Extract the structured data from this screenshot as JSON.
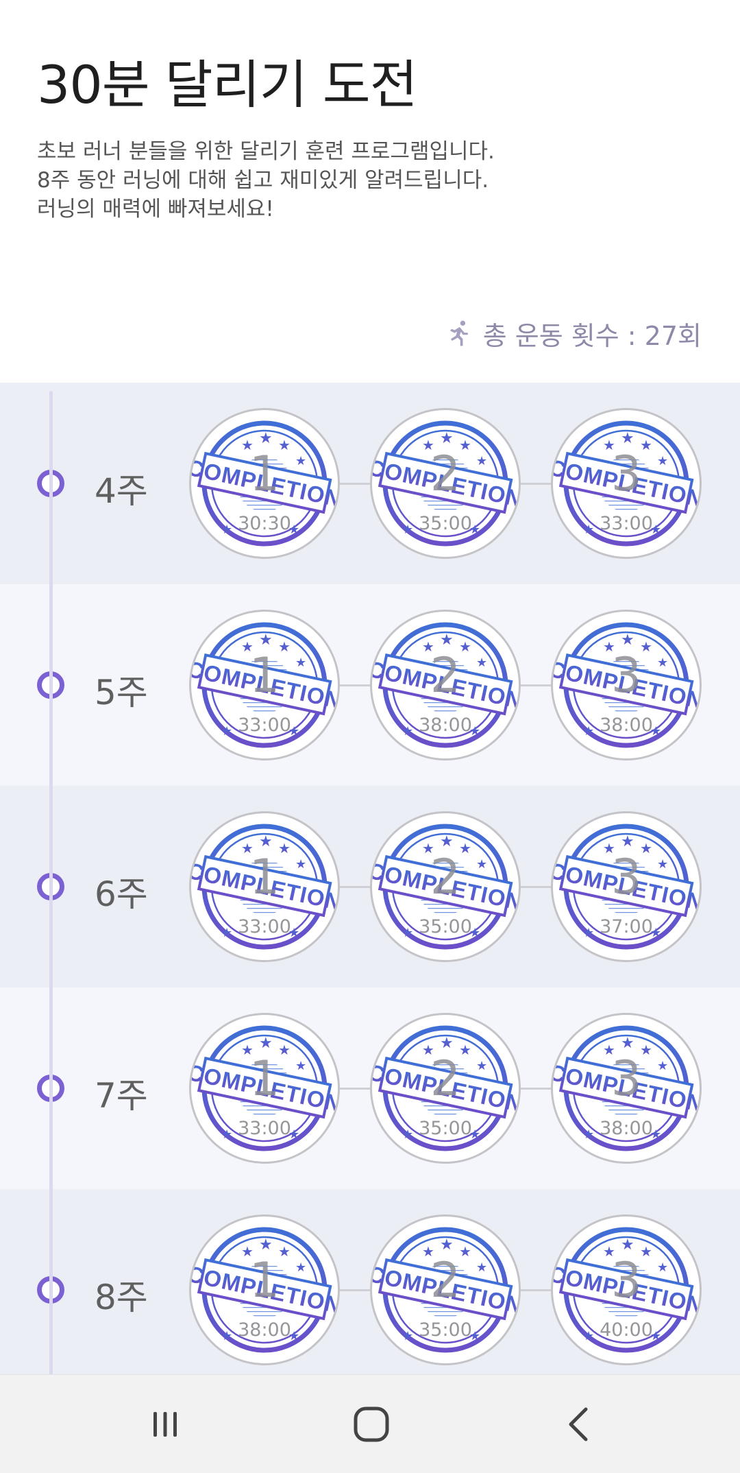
{
  "header": {
    "title": "30분 달리기 도전",
    "description": [
      "초보 러너 분들을 위한 달리기 훈련 프로그램입니다.",
      "8주 동안 러닝에 대해 쉽고 재미있게 알려드립니다.",
      "러닝의 매력에 빠져보세요!"
    ],
    "total_label": "총 운동 횟수 : 27회",
    "total_icon": "running-person-icon"
  },
  "colors": {
    "accent": "#7b61d1",
    "stamp_blue": "#3f6fd6",
    "stamp_purple": "#6a4fc9",
    "row_shade": "#eceef6",
    "row_light": "#f5f6fb"
  },
  "weeks": [
    {
      "label": "4주",
      "sessions": [
        {
          "num": "1",
          "time": "30:30",
          "status": "COMPLETION"
        },
        {
          "num": "2",
          "time": "35:00",
          "status": "COMPLETION"
        },
        {
          "num": "3",
          "time": "33:00",
          "status": "COMPLETION"
        }
      ]
    },
    {
      "label": "5주",
      "sessions": [
        {
          "num": "1",
          "time": "33:00",
          "status": "COMPLETION"
        },
        {
          "num": "2",
          "time": "38:00",
          "status": "COMPLETION"
        },
        {
          "num": "3",
          "time": "38:00",
          "status": "COMPLETION"
        }
      ]
    },
    {
      "label": "6주",
      "sessions": [
        {
          "num": "1",
          "time": "33:00",
          "status": "COMPLETION"
        },
        {
          "num": "2",
          "time": "35:00",
          "status": "COMPLETION"
        },
        {
          "num": "3",
          "time": "37:00",
          "status": "COMPLETION"
        }
      ]
    },
    {
      "label": "7주",
      "sessions": [
        {
          "num": "1",
          "time": "33:00",
          "status": "COMPLETION"
        },
        {
          "num": "2",
          "time": "35:00",
          "status": "COMPLETION"
        },
        {
          "num": "3",
          "time": "38:00",
          "status": "COMPLETION"
        }
      ]
    },
    {
      "label": "8주",
      "sessions": [
        {
          "num": "1",
          "time": "38:00",
          "status": "COMPLETION"
        },
        {
          "num": "2",
          "time": "35:00",
          "status": "COMPLETION"
        },
        {
          "num": "3",
          "time": "40:00",
          "status": "COMPLETION"
        }
      ]
    }
  ],
  "navbar": {
    "recent_icon": "recent-apps-icon",
    "home_icon": "home-icon",
    "back_icon": "back-icon"
  }
}
